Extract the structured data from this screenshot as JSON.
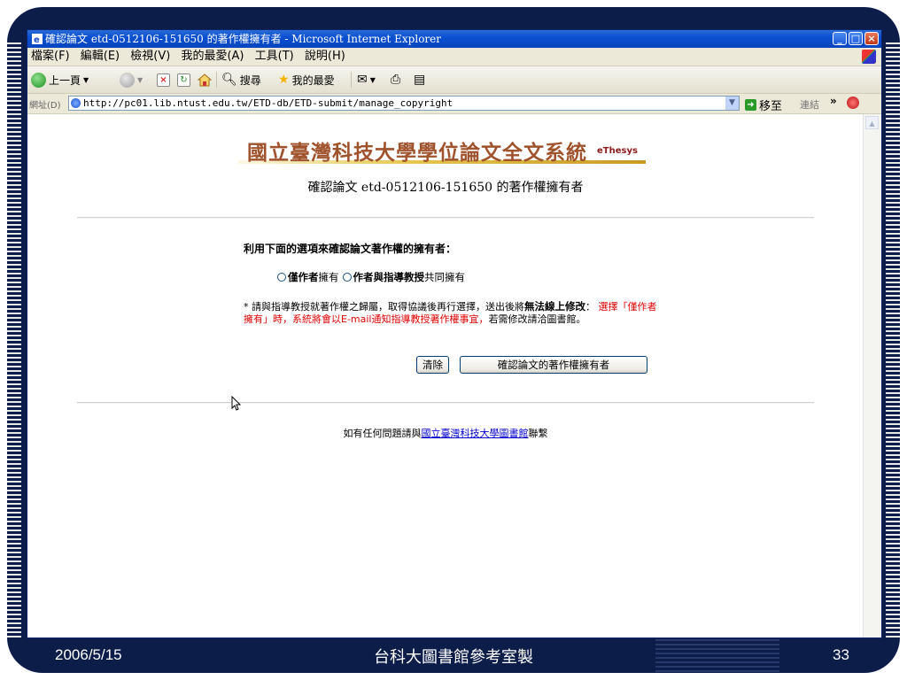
{
  "window": {
    "title": "確認論文 etd-0512106-151650 的著作權擁有者 - Microsoft Internet Explorer"
  },
  "menu": {
    "items": [
      "檔案(F)",
      "編輯(E)",
      "檢視(V)",
      "我的最愛(A)",
      "工具(T)",
      "說明(H)"
    ]
  },
  "toolbar": {
    "back_label": "上一頁",
    "search_label": "搜尋",
    "favorites_label": "我的最愛"
  },
  "address": {
    "label": "網址(D)",
    "url": "http://pc01.lib.ntust.edu.tw/ETD-db/ETD-submit/manage_copyright",
    "go_label": "移至",
    "links_label": "連結"
  },
  "page": {
    "site_title": "國立臺灣科技大學學位論文全文系統",
    "site_tag": "eThesys",
    "heading": "確認論文 etd-0512106-151650 的著作權擁有者",
    "prompt": "利用下面的選項來確認論文著作權的擁有者：",
    "option1_bold": "僅作者",
    "option1_rest": "擁有",
    "option2_bold": "作者與指導教授",
    "option2_rest": "共同擁有",
    "note_part1": "* 請與指導教授就著作權之歸屬，取得協議後再行選擇，送出後將",
    "note_bold": "無法線上修改",
    "note_colon": "：",
    "note_red": " 選擇「僅作者擁有」時，系統將會以E-mail通知指導教授著作權事宜，",
    "note_part2": "若需修改請洽圖書館。",
    "clear_button": "清除",
    "confirm_button": "確認論文的著作權擁有者",
    "footer_prefix": "如有任何問題請與",
    "footer_link": "國立臺灣科技大學圖書館",
    "footer_suffix": "聯繫"
  },
  "slide": {
    "date": "2006/5/15",
    "center_text": "台科大圖書館參考室製",
    "page_number": "33"
  },
  "colors": {
    "slide_bg": "#0d1d4a",
    "site_title": "#a0522d",
    "note_red": "#e00000",
    "link": "#0000cc"
  }
}
